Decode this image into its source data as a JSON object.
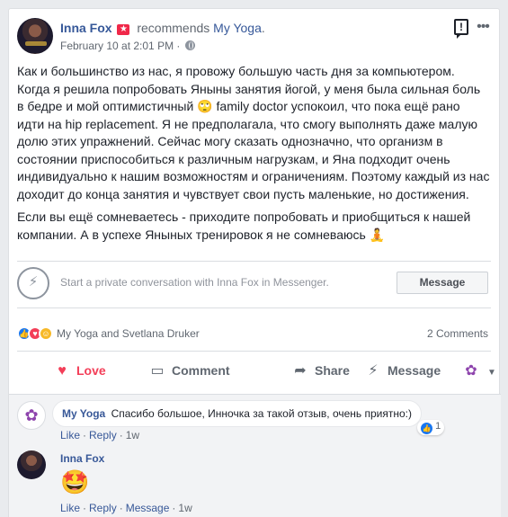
{
  "post": {
    "author": "Inna Fox",
    "recommends_text": "recommends",
    "page_name": "My Yoga",
    "date": "February 10 at 2:01 PM",
    "date_separator": "·",
    "paragraphs": [
      "Как и большинство из нас, я провожу большую часть дня за компьютером. Когда я решила попробовать Яныны занятия йогой, у меня была сильная боль в бедре и мой оптимистичный 🙄 family doctor успокоил, что пока ещё рано идти на hip replacement. Я не предполагала, что смогу выполнять даже малую долю этих упражнений. Сейчас могу сказать однозначно, что организм в состоянии приспособиться к различным нагрузкам, и Яна подходит очень индивидуально к нашим возможностям и ограничениям. Поэтому каждый из нас доходит до конца занятия и чувствует свои пусть маленькие, но достижения.",
      "Если вы ещё сомневаетесь - приходите попробовать и приобщиться к нашей компании. А в успехе Яныных тренировок я не сомневаюсь 🧘"
    ]
  },
  "messenger": {
    "prompt": "Start a private conversation with Inna Fox in Messenger.",
    "button_label": "Message"
  },
  "reactions": {
    "reactors": "My Yoga and Svetlana Druker",
    "comments_count": "2 Comments"
  },
  "actions": {
    "love": "Love",
    "comment": "Comment",
    "share": "Share",
    "message": "Message"
  },
  "comments": [
    {
      "author": "My Yoga",
      "text": "Спасибо большое, Инночка за такой отзыв, очень приятно:)",
      "like_count": "1",
      "like": "Like",
      "reply": "Reply",
      "time": "1w"
    },
    {
      "author": "Inna Fox",
      "emoji": "🤩",
      "like": "Like",
      "reply": "Reply",
      "message": "Message",
      "time": "1w"
    }
  ],
  "separator": "·",
  "colors": {
    "link": "#365899",
    "love": "#f33e58",
    "like_blue": "#1877f2",
    "background": "#e9ebee"
  }
}
